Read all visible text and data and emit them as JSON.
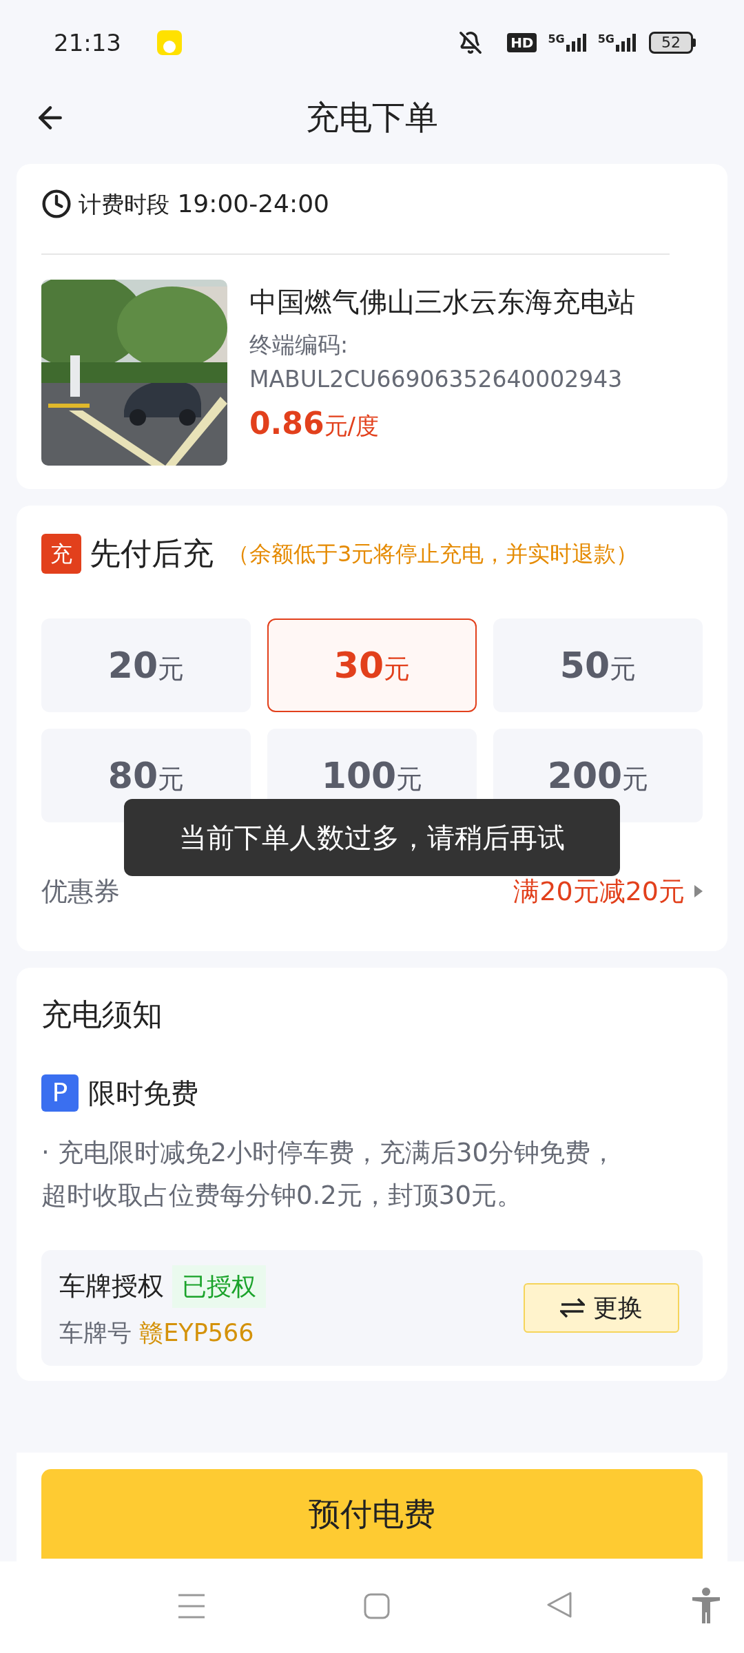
{
  "status_bar": {
    "time": "21:13",
    "hd": "HD",
    "networks": [
      "5G",
      "5G"
    ],
    "battery": "52"
  },
  "header": {
    "title": "充电下单"
  },
  "station": {
    "billing_label": "计费时段",
    "billing_period": "19:00-24:00",
    "name": "中国燃气佛山三水云东海充电站",
    "terminal_label": "终端编码:",
    "terminal_code": "MABUL2CU66906352640002943",
    "price": "0.86",
    "price_unit": "元/度"
  },
  "prepay": {
    "badge": "充",
    "title": "先付后充",
    "note": "（余额低于3元将停止充电，并实时退款）",
    "amounts": [
      {
        "value": "20",
        "unit": "元",
        "selected": false
      },
      {
        "value": "30",
        "unit": "元",
        "selected": true
      },
      {
        "value": "50",
        "unit": "元",
        "selected": false
      },
      {
        "value": "80",
        "unit": "元",
        "selected": false
      },
      {
        "value": "100",
        "unit": "元",
        "selected": false
      },
      {
        "value": "200",
        "unit": "元",
        "selected": false
      }
    ],
    "coupon_label": "优惠券",
    "coupon_value": "满20元减20元"
  },
  "notice": {
    "title": "充电须知",
    "parking_badge": "P",
    "parking_title": "限时免费",
    "parking_text": "· 充电限时减免2小时停车费，充满后30分钟免费，超时收取占位费每分钟0.2元，封顶30元。",
    "plate": {
      "title": "车牌授权",
      "authorized": true,
      "status": "已授权",
      "plate_label": "车牌号",
      "plate_number": "赣EYP566",
      "change_button": "更换"
    }
  },
  "submit_button": "预付电费",
  "toast": "当前下单人数过多，请稍后再试"
}
